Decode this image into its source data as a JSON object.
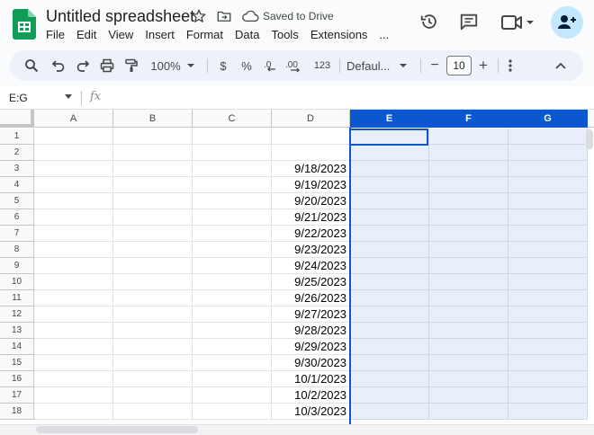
{
  "title": {
    "doc_name": "Untitled spreadsheet",
    "saved_status": "Saved to Drive"
  },
  "menu": [
    "File",
    "Edit",
    "View",
    "Insert",
    "Format",
    "Data",
    "Tools",
    "Extensions",
    "..."
  ],
  "toolbar": {
    "zoom": "100%",
    "currency": "$",
    "percent": "%",
    "number_format": "123",
    "font": "Defaul...",
    "font_size": "10",
    "minus": "−",
    "plus": "+"
  },
  "formula_bar": {
    "name_box": "E:G",
    "fx": "fx"
  },
  "columns": [
    "A",
    "B",
    "C",
    "D",
    "E",
    "F",
    "G"
  ],
  "selected_columns": [
    "E",
    "F",
    "G"
  ],
  "rows": [
    "1",
    "2",
    "3",
    "4",
    "5",
    "6",
    "7",
    "8",
    "9",
    "10",
    "11",
    "12",
    "13",
    "14",
    "15",
    "16",
    "17",
    "18"
  ],
  "column_d_values": [
    "",
    "",
    "9/18/2023",
    "9/19/2023",
    "9/20/2023",
    "9/21/2023",
    "9/22/2023",
    "9/23/2023",
    "9/24/2023",
    "9/25/2023",
    "9/26/2023",
    "9/27/2023",
    "9/28/2023",
    "9/29/2023",
    "9/30/2023",
    "10/1/2023",
    "10/2/2023",
    "10/3/2023"
  ],
  "colors": {
    "selection_header": "#0b57d0",
    "selection_fill": "#e8effb",
    "share_button": "#c2e7ff",
    "logo_green": "#0f9d58"
  }
}
